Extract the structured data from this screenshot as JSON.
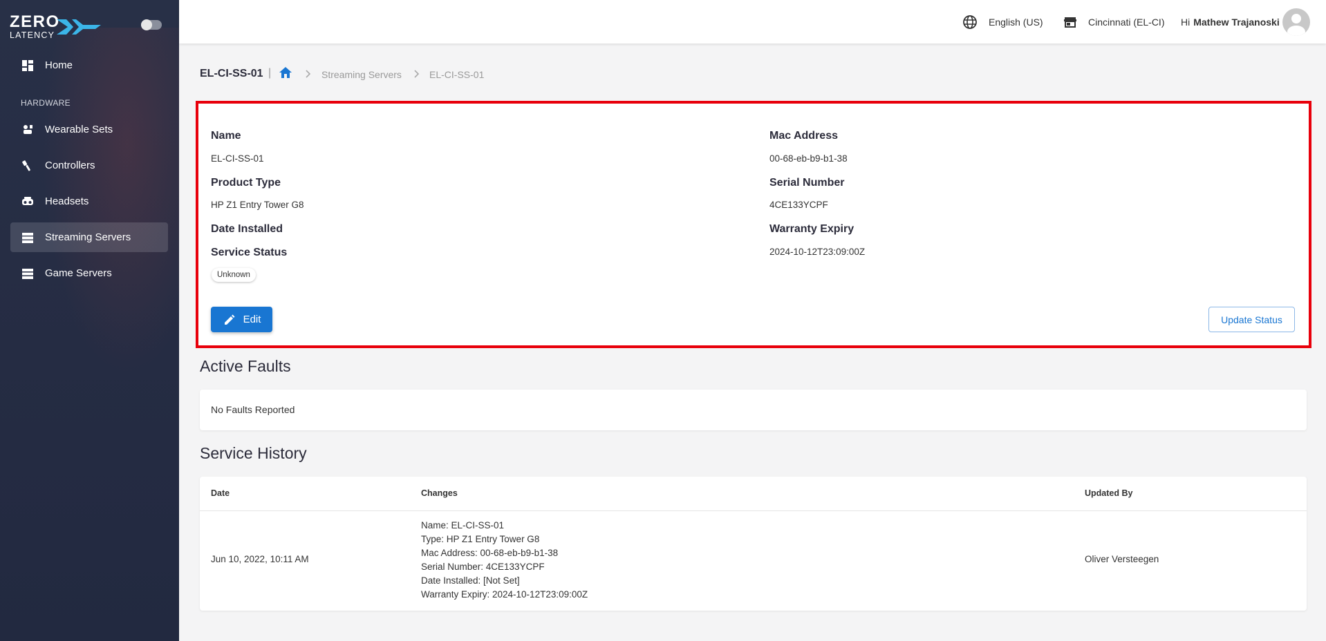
{
  "brand": {
    "line1": "ZERO",
    "line2": "LATENCY"
  },
  "sidebar": {
    "home": "Home",
    "section": "HARDWARE",
    "items": [
      {
        "label": "Wearable Sets",
        "icon": "wearable-sets-icon"
      },
      {
        "label": "Controllers",
        "icon": "controller-icon"
      },
      {
        "label": "Headsets",
        "icon": "headset-icon"
      },
      {
        "label": "Streaming Servers",
        "icon": "server-icon",
        "active": true
      },
      {
        "label": "Game Servers",
        "icon": "server-icon"
      }
    ]
  },
  "topbar": {
    "language": "English (US)",
    "location": "Cincinnati (EL-CI)",
    "greeting": "Hi",
    "user": "Mathew Trajanoski"
  },
  "breadcrumb": {
    "title": "EL-CI-SS-01",
    "separator": "|",
    "path": [
      "Streaming Servers",
      "EL-CI-SS-01"
    ]
  },
  "details": {
    "name_label": "Name",
    "name": "EL-CI-SS-01",
    "product_type_label": "Product Type",
    "product_type": "HP Z1 Entry Tower G8",
    "date_installed_label": "Date Installed",
    "service_status_label": "Service Status",
    "service_status": "Unknown",
    "mac_label": "Mac Address",
    "mac": "00-68-eb-b9-b1-38",
    "serial_label": "Serial Number",
    "serial": "4CE133YCPF",
    "warranty_label": "Warranty Expiry",
    "warranty": "2024-10-12T23:09:00Z",
    "edit_label": "Edit",
    "update_status_label": "Update Status"
  },
  "active_faults": {
    "heading": "Active Faults",
    "empty_text": "No Faults Reported"
  },
  "service_history": {
    "heading": "Service History",
    "columns": [
      "Date",
      "Changes",
      "Updated By"
    ],
    "rows": [
      {
        "date": "Jun 10, 2022, 10:11 AM",
        "changes": [
          "Name: EL-CI-SS-01",
          "Type: HP Z1 Entry Tower G8",
          "Mac Address: 00-68-eb-b9-b1-38",
          "Serial Number: 4CE133YCPF",
          "Date Installed: [Not Set]",
          "Warranty Expiry: 2024-10-12T23:09:00Z"
        ],
        "updated_by": "Oliver Versteegen"
      }
    ]
  },
  "colors": {
    "primary": "#1976d2",
    "highlight": "#e8000b",
    "sidebar": "#262d44"
  }
}
